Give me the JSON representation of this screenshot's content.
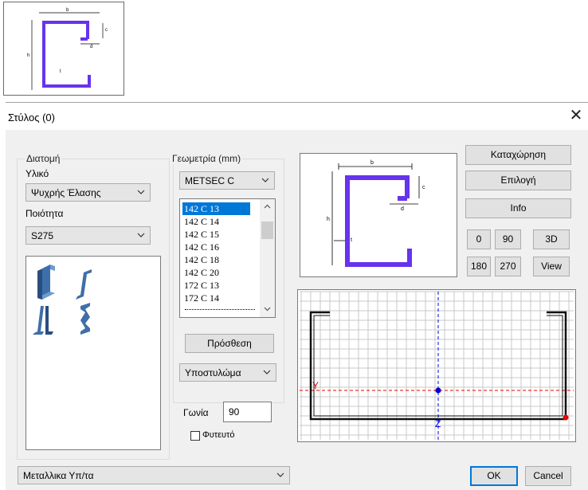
{
  "dialog": {
    "title": "Στύλος (0)",
    "close_label": "✕"
  },
  "section": {
    "group_label": "Διατομή",
    "material_label": "Υλικό",
    "material_value": "Ψυχρής Έλασης",
    "quality_label": "Ποιότητα",
    "quality_value": "S275"
  },
  "geometry": {
    "group_label": "Γεωμετρία (mm)",
    "series_value": "METSEC C",
    "profiles": [
      "142 C 13",
      "142 C 14",
      "142 C 15",
      "142 C 16",
      "142 C 18",
      "142 C 20",
      "172 C 13",
      "172 C 14"
    ],
    "selected_index": 0,
    "add_button": "Πρόσθεση",
    "support_value": "Υποστυλώμα",
    "angle_label": "Γωνία",
    "angle_value": "90",
    "plant_label": "Φυτευτό",
    "plant_checked": false
  },
  "actions": {
    "register": "Καταχώρηση",
    "select": "Επιλογή",
    "info": "Info",
    "rot0": "0",
    "rot90": "90",
    "rot180": "180",
    "rot270": "270",
    "view3d": "3D",
    "view": "View"
  },
  "drawing": {
    "dim_b": "b",
    "dim_c": "c",
    "dim_d": "d",
    "dim_h": "h",
    "dim_t": "t",
    "axis_y": "Y",
    "axis_z": "Z",
    "profile_color": "#6633ee"
  },
  "footer": {
    "category_value": "Μεταλλικα Υπ/τα",
    "ok": "OK",
    "cancel": "Cancel"
  }
}
